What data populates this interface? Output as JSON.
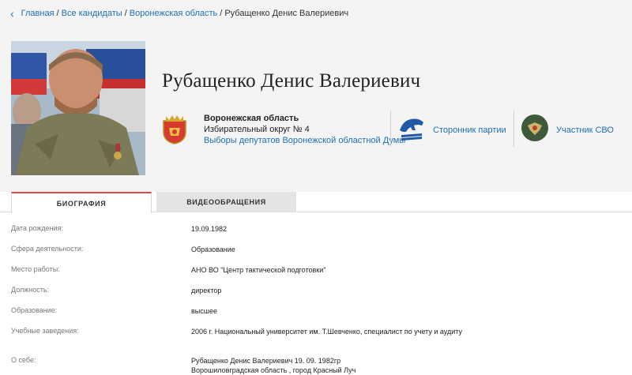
{
  "breadcrumb": {
    "back_icon": "chevron-left-icon",
    "items": [
      "Главная",
      "Все кандидаты",
      "Воронежская область"
    ],
    "current": "Рубащенко Денис Валериевич",
    "separator": "/"
  },
  "candidate": {
    "name": "Рубащенко Денис Валериевич",
    "region": "Воронежская область",
    "okrug": "Избирательный округ № 4",
    "election_link": "Выборы депутатов Воронежской областной Думы"
  },
  "badges": {
    "party": {
      "icon": "party-bear-logo-icon",
      "label": "Сторонник партии"
    },
    "svo": {
      "icon": "army-emblem-icon",
      "label": "Участник СВО"
    }
  },
  "tabs": [
    {
      "label": "БИОГРАФИЯ",
      "active": true
    },
    {
      "label": "ВИДЕООБРАЩЕНИЯ",
      "active": false
    }
  ],
  "bio": {
    "birth_label": "Дата рождения:",
    "birth_value": "19.09.1982",
    "sphere_label": "Сфера деятельности:",
    "sphere_value": "Образование",
    "work_label": "Место работы:",
    "work_value": "АНО ВО \"Центр тактической подготовки\"",
    "position_label": "Должность:",
    "position_value": "директор",
    "education_label": "Образование:",
    "education_value": "высшее",
    "schools_label": "Учебные заведения:",
    "schools_value": "2006 г. Национальный университет им. Т.Шевченко, специалист по учету и аудиту",
    "about_label": "О себе:",
    "about_line1": "Рубащенко Денис Валериевич 19. 09. 1982гр",
    "about_line2": "Ворошиловградская область , город Красный Луч"
  },
  "colors": {
    "link": "#1f6eb5",
    "active_tab_border": "#e64848",
    "header_bg": "#f4f4f4"
  }
}
